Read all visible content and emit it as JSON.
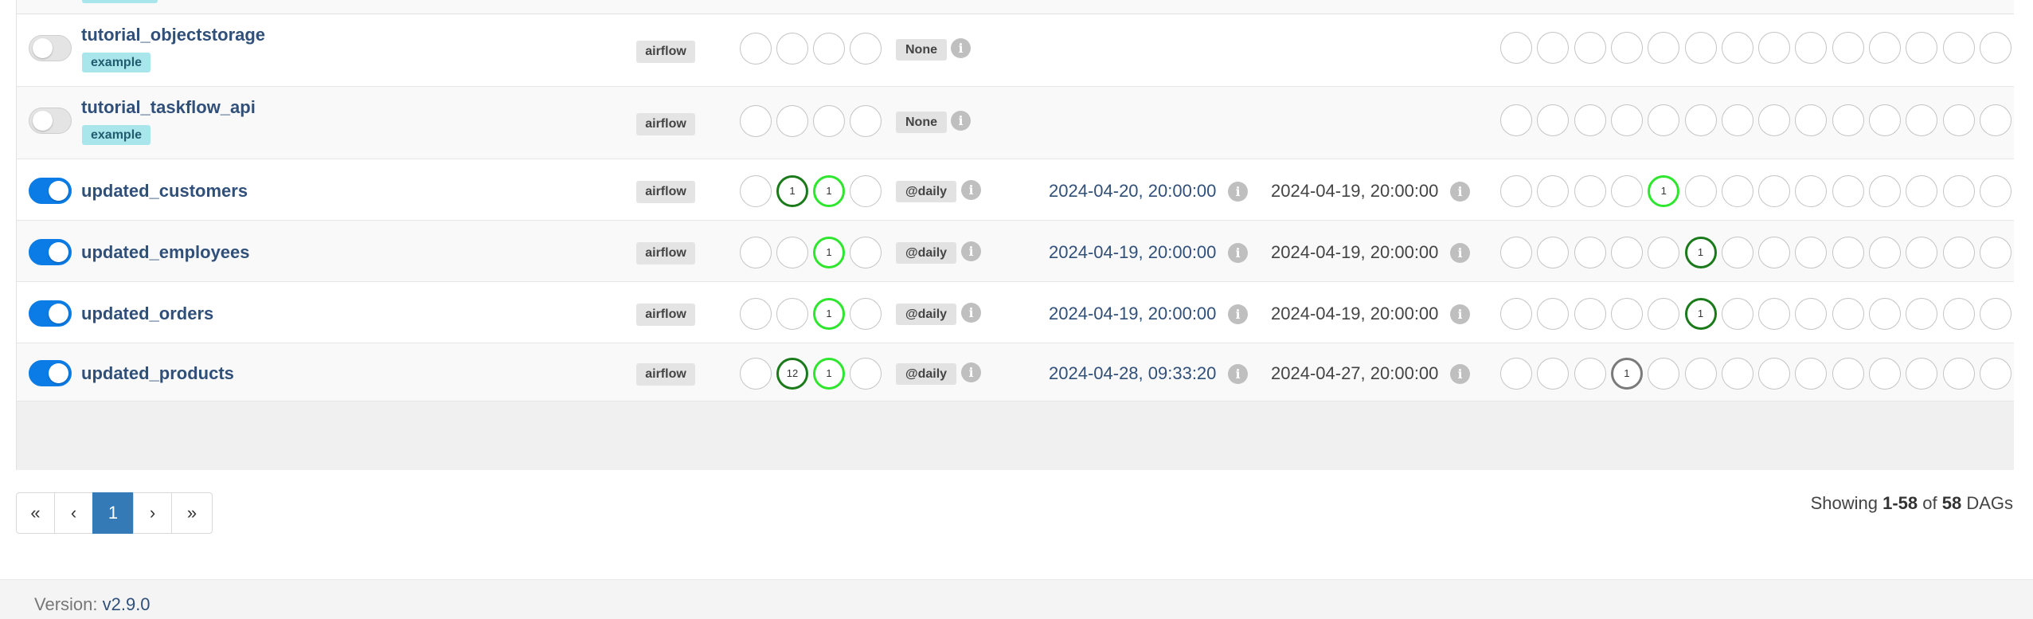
{
  "dags": [
    {
      "name": "tutorial_objectstorage",
      "active": false,
      "tag": "example",
      "owner": "airflow",
      "runs": [
        {
          "count": "",
          "style": "empty"
        },
        {
          "count": "",
          "style": "empty"
        },
        {
          "count": "",
          "style": "empty"
        },
        {
          "count": "",
          "style": "empty"
        }
      ],
      "schedule": "None",
      "next_run": "",
      "last_run": "",
      "tasks": [
        {
          "count": "",
          "style": "empty"
        },
        {
          "count": "",
          "style": "empty"
        },
        {
          "count": "",
          "style": "empty"
        },
        {
          "count": "",
          "style": "empty"
        },
        {
          "count": "",
          "style": "empty"
        },
        {
          "count": "",
          "style": "empty"
        },
        {
          "count": "",
          "style": "empty"
        },
        {
          "count": "",
          "style": "empty"
        },
        {
          "count": "",
          "style": "empty"
        },
        {
          "count": "",
          "style": "empty"
        },
        {
          "count": "",
          "style": "empty"
        },
        {
          "count": "",
          "style": "empty"
        },
        {
          "count": "",
          "style": "empty"
        },
        {
          "count": "",
          "style": "empty"
        }
      ]
    },
    {
      "name": "tutorial_taskflow_api",
      "active": false,
      "tag": "example",
      "owner": "airflow",
      "runs": [
        {
          "count": "",
          "style": "empty"
        },
        {
          "count": "",
          "style": "empty"
        },
        {
          "count": "",
          "style": "empty"
        },
        {
          "count": "",
          "style": "empty"
        }
      ],
      "schedule": "None",
      "next_run": "",
      "last_run": "",
      "tasks": [
        {
          "count": "",
          "style": "empty"
        },
        {
          "count": "",
          "style": "empty"
        },
        {
          "count": "",
          "style": "empty"
        },
        {
          "count": "",
          "style": "empty"
        },
        {
          "count": "",
          "style": "empty"
        },
        {
          "count": "",
          "style": "empty"
        },
        {
          "count": "",
          "style": "empty"
        },
        {
          "count": "",
          "style": "empty"
        },
        {
          "count": "",
          "style": "empty"
        },
        {
          "count": "",
          "style": "empty"
        },
        {
          "count": "",
          "style": "empty"
        },
        {
          "count": "",
          "style": "empty"
        },
        {
          "count": "",
          "style": "empty"
        },
        {
          "count": "",
          "style": "empty"
        }
      ]
    },
    {
      "name": "updated_customers",
      "active": true,
      "tag": "",
      "owner": "airflow",
      "runs": [
        {
          "count": "",
          "style": "empty"
        },
        {
          "count": "1",
          "style": "dkgreen"
        },
        {
          "count": "1",
          "style": "ltgreen"
        },
        {
          "count": "",
          "style": "empty"
        }
      ],
      "schedule": "@daily",
      "next_run": "2024-04-20, 20:00:00",
      "last_run": "2024-04-19, 20:00:00",
      "tasks": [
        {
          "count": "",
          "style": "empty"
        },
        {
          "count": "",
          "style": "empty"
        },
        {
          "count": "",
          "style": "empty"
        },
        {
          "count": "",
          "style": "empty"
        },
        {
          "count": "1",
          "style": "ltgreen"
        },
        {
          "count": "",
          "style": "empty"
        },
        {
          "count": "",
          "style": "empty"
        },
        {
          "count": "",
          "style": "empty"
        },
        {
          "count": "",
          "style": "empty"
        },
        {
          "count": "",
          "style": "empty"
        },
        {
          "count": "",
          "style": "empty"
        },
        {
          "count": "",
          "style": "empty"
        },
        {
          "count": "",
          "style": "empty"
        },
        {
          "count": "",
          "style": "empty"
        }
      ]
    },
    {
      "name": "updated_employees",
      "active": true,
      "tag": "",
      "owner": "airflow",
      "runs": [
        {
          "count": "",
          "style": "empty"
        },
        {
          "count": "",
          "style": "empty"
        },
        {
          "count": "1",
          "style": "ltgreen"
        },
        {
          "count": "",
          "style": "empty"
        }
      ],
      "schedule": "@daily",
      "next_run": "2024-04-19, 20:00:00",
      "last_run": "2024-04-19, 20:00:00",
      "tasks": [
        {
          "count": "",
          "style": "empty"
        },
        {
          "count": "",
          "style": "empty"
        },
        {
          "count": "",
          "style": "empty"
        },
        {
          "count": "",
          "style": "empty"
        },
        {
          "count": "",
          "style": "empty"
        },
        {
          "count": "1",
          "style": "dkgreen"
        },
        {
          "count": "",
          "style": "empty"
        },
        {
          "count": "",
          "style": "empty"
        },
        {
          "count": "",
          "style": "empty"
        },
        {
          "count": "",
          "style": "empty"
        },
        {
          "count": "",
          "style": "empty"
        },
        {
          "count": "",
          "style": "empty"
        },
        {
          "count": "",
          "style": "empty"
        },
        {
          "count": "",
          "style": "empty"
        }
      ]
    },
    {
      "name": "updated_orders",
      "active": true,
      "tag": "",
      "owner": "airflow",
      "runs": [
        {
          "count": "",
          "style": "empty"
        },
        {
          "count": "",
          "style": "empty"
        },
        {
          "count": "1",
          "style": "ltgreen"
        },
        {
          "count": "",
          "style": "empty"
        }
      ],
      "schedule": "@daily",
      "next_run": "2024-04-19, 20:00:00",
      "last_run": "2024-04-19, 20:00:00",
      "tasks": [
        {
          "count": "",
          "style": "empty"
        },
        {
          "count": "",
          "style": "empty"
        },
        {
          "count": "",
          "style": "empty"
        },
        {
          "count": "",
          "style": "empty"
        },
        {
          "count": "",
          "style": "empty"
        },
        {
          "count": "1",
          "style": "dkgreen"
        },
        {
          "count": "",
          "style": "empty"
        },
        {
          "count": "",
          "style": "empty"
        },
        {
          "count": "",
          "style": "empty"
        },
        {
          "count": "",
          "style": "empty"
        },
        {
          "count": "",
          "style": "empty"
        },
        {
          "count": "",
          "style": "empty"
        },
        {
          "count": "",
          "style": "empty"
        },
        {
          "count": "",
          "style": "empty"
        }
      ]
    },
    {
      "name": "updated_products",
      "active": true,
      "tag": "",
      "owner": "airflow",
      "runs": [
        {
          "count": "",
          "style": "empty"
        },
        {
          "count": "12",
          "style": "dkgreen"
        },
        {
          "count": "1",
          "style": "ltgreen"
        },
        {
          "count": "",
          "style": "empty"
        }
      ],
      "schedule": "@daily",
      "next_run": "2024-04-28, 09:33:20",
      "last_run": "2024-04-27, 20:00:00",
      "tasks": [
        {
          "count": "",
          "style": "empty"
        },
        {
          "count": "",
          "style": "empty"
        },
        {
          "count": "",
          "style": "empty"
        },
        {
          "count": "1",
          "style": "gray"
        },
        {
          "count": "",
          "style": "empty"
        },
        {
          "count": "",
          "style": "empty"
        },
        {
          "count": "",
          "style": "empty"
        },
        {
          "count": "",
          "style": "empty"
        },
        {
          "count": "",
          "style": "empty"
        },
        {
          "count": "",
          "style": "empty"
        },
        {
          "count": "",
          "style": "empty"
        },
        {
          "count": "",
          "style": "empty"
        },
        {
          "count": "",
          "style": "empty"
        },
        {
          "count": "",
          "style": "empty"
        }
      ]
    }
  ],
  "info_glyph": "i",
  "pagination": {
    "first": "«",
    "prev": "‹",
    "current": "1",
    "next": "›",
    "last": "»"
  },
  "showing": {
    "prefix": "Showing ",
    "range": "1-58",
    "middle": " of ",
    "total": "58",
    "suffix": " DAGs"
  },
  "footer": {
    "version_label": "Version: ",
    "version": "v2.9.0"
  },
  "colors": {
    "toggle_on": "#0b7ce6",
    "success_dark": "#1a7a1a",
    "success_light": "#2ee62e",
    "queued_gray": "#7a7a7a",
    "link": "#30507a",
    "page_active": "#337ab7"
  }
}
